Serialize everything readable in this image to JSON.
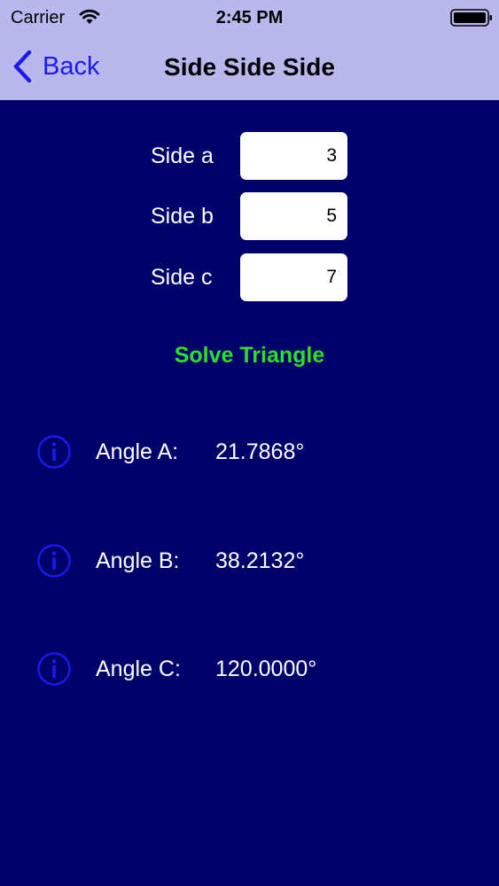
{
  "status_bar": {
    "carrier": "Carrier",
    "time": "2:45 PM"
  },
  "nav": {
    "back_label": "Back",
    "title": "Side Side Side"
  },
  "sides": [
    {
      "label": "Side a",
      "value": "3"
    },
    {
      "label": "Side b",
      "value": "5"
    },
    {
      "label": "Side c",
      "value": "7"
    }
  ],
  "solve_label": "Solve Triangle",
  "angles": [
    {
      "label": "Angle A:",
      "value": "21.7868°"
    },
    {
      "label": "Angle B:",
      "value": "38.2132°"
    },
    {
      "label": "Angle C:",
      "value": "120.0000°"
    }
  ],
  "colors": {
    "background": "#00006b",
    "nav_bar": "#b8b8ee",
    "accent_blue": "#1a1af0",
    "solve_green": "#2ae02a",
    "text": "#ffffff"
  },
  "icons": {
    "back": "chevron-left-icon",
    "wifi": "wifi-icon",
    "battery": "battery-icon",
    "info": "info-circle-icon"
  }
}
